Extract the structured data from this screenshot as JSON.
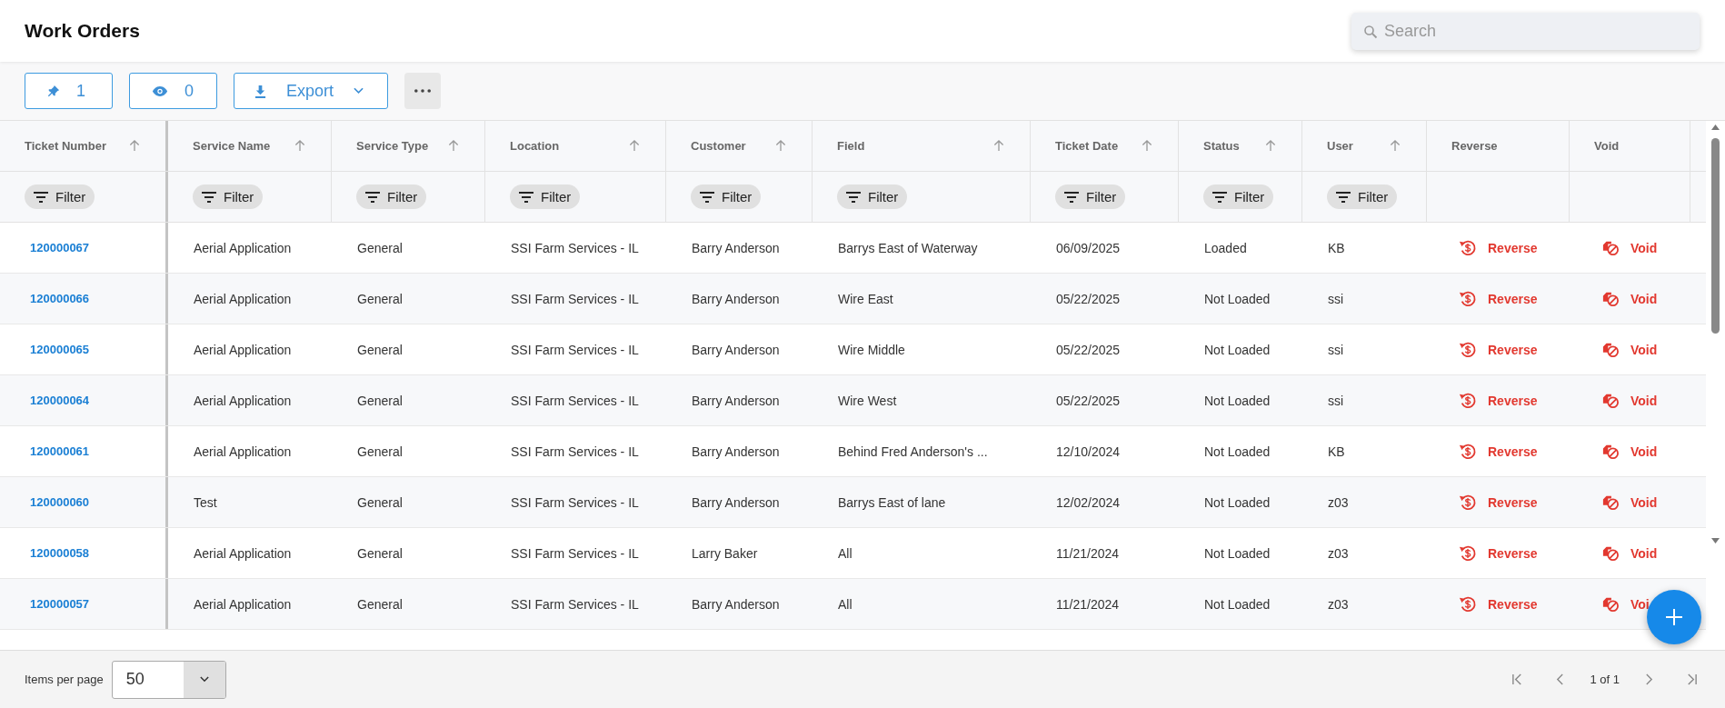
{
  "page": {
    "title": "Work Orders"
  },
  "search": {
    "placeholder": "Search"
  },
  "toolbar": {
    "pinned_count": "1",
    "visible_count": "0",
    "export": "Export"
  },
  "table": {
    "columns": [
      {
        "label": "Ticket Number",
        "sortable": true,
        "filter": "Filter",
        "pinned": true
      },
      {
        "label": "Service Name",
        "sortable": true,
        "filter": "Filter",
        "pinned": false
      },
      {
        "label": "Service Type",
        "sortable": true,
        "filter": "Filter",
        "pinned": false
      },
      {
        "label": "Location",
        "sortable": true,
        "filter": "Filter",
        "pinned": false
      },
      {
        "label": "Customer",
        "sortable": true,
        "filter": "Filter",
        "pinned": false
      },
      {
        "label": "Field",
        "sortable": true,
        "filter": "Filter",
        "pinned": false
      },
      {
        "label": "Ticket Date",
        "sortable": true,
        "filter": "Filter",
        "pinned": false
      },
      {
        "label": "Status",
        "sortable": true,
        "filter": "Filter",
        "pinned": false
      },
      {
        "label": "User",
        "sortable": true,
        "filter": "Filter",
        "pinned": false
      },
      {
        "label": "Reverse",
        "sortable": false
      },
      {
        "label": "Void",
        "sortable": false
      }
    ],
    "rows": [
      {
        "ticket_number": "120000067",
        "service_name": "Aerial Application",
        "service_type": "General",
        "location": "SSI Farm Services - IL",
        "customer": "Barry Anderson",
        "field": "Barrys East of Waterway",
        "ticket_date": "06/09/2025",
        "status": "Loaded",
        "user": "KB",
        "reverse": "Reverse",
        "void": "Void"
      },
      {
        "ticket_number": "120000066",
        "service_name": "Aerial Application",
        "service_type": "General",
        "location": "SSI Farm Services - IL",
        "customer": "Barry Anderson",
        "field": "Wire East",
        "ticket_date": "05/22/2025",
        "status": "Not Loaded",
        "user": "ssi",
        "reverse": "Reverse",
        "void": "Void"
      },
      {
        "ticket_number": "120000065",
        "service_name": "Aerial Application",
        "service_type": "General",
        "location": "SSI Farm Services - IL",
        "customer": "Barry Anderson",
        "field": "Wire Middle",
        "ticket_date": "05/22/2025",
        "status": "Not Loaded",
        "user": "ssi",
        "reverse": "Reverse",
        "void": "Void"
      },
      {
        "ticket_number": "120000064",
        "service_name": "Aerial Application",
        "service_type": "General",
        "location": "SSI Farm Services - IL",
        "customer": "Barry Anderson",
        "field": "Wire West",
        "ticket_date": "05/22/2025",
        "status": "Not Loaded",
        "user": "ssi",
        "reverse": "Reverse",
        "void": "Void"
      },
      {
        "ticket_number": "120000061",
        "service_name": "Aerial Application",
        "service_type": "General",
        "location": "SSI Farm Services - IL",
        "customer": "Barry Anderson",
        "field": "Behind Fred Anderson's ...",
        "ticket_date": "12/10/2024",
        "status": "Not Loaded",
        "user": "KB",
        "reverse": "Reverse",
        "void": "Void"
      },
      {
        "ticket_number": "120000060",
        "service_name": "Test",
        "service_type": "General",
        "location": "SSI Farm Services - IL",
        "customer": "Barry Anderson",
        "field": "Barrys East of lane",
        "ticket_date": "12/02/2024",
        "status": "Not Loaded",
        "user": "z03",
        "reverse": "Reverse",
        "void": "Void"
      },
      {
        "ticket_number": "120000058",
        "service_name": "Aerial Application",
        "service_type": "General",
        "location": "SSI Farm Services - IL",
        "customer": "Larry Baker",
        "field": "All",
        "ticket_date": "11/21/2024",
        "status": "Not Loaded",
        "user": "z03",
        "reverse": "Reverse",
        "void": "Void"
      },
      {
        "ticket_number": "120000057",
        "service_name": "Aerial Application",
        "service_type": "General",
        "location": "SSI Farm Services - IL",
        "customer": "Barry Anderson",
        "field": "All",
        "ticket_date": "11/21/2024",
        "status": "Not Loaded",
        "user": "z03",
        "reverse": "Reverse",
        "void": "Voi"
      }
    ]
  },
  "pagination": {
    "items_per_page_label": "Items per page",
    "items_per_page": "50",
    "page_info": "1 of 1"
  }
}
